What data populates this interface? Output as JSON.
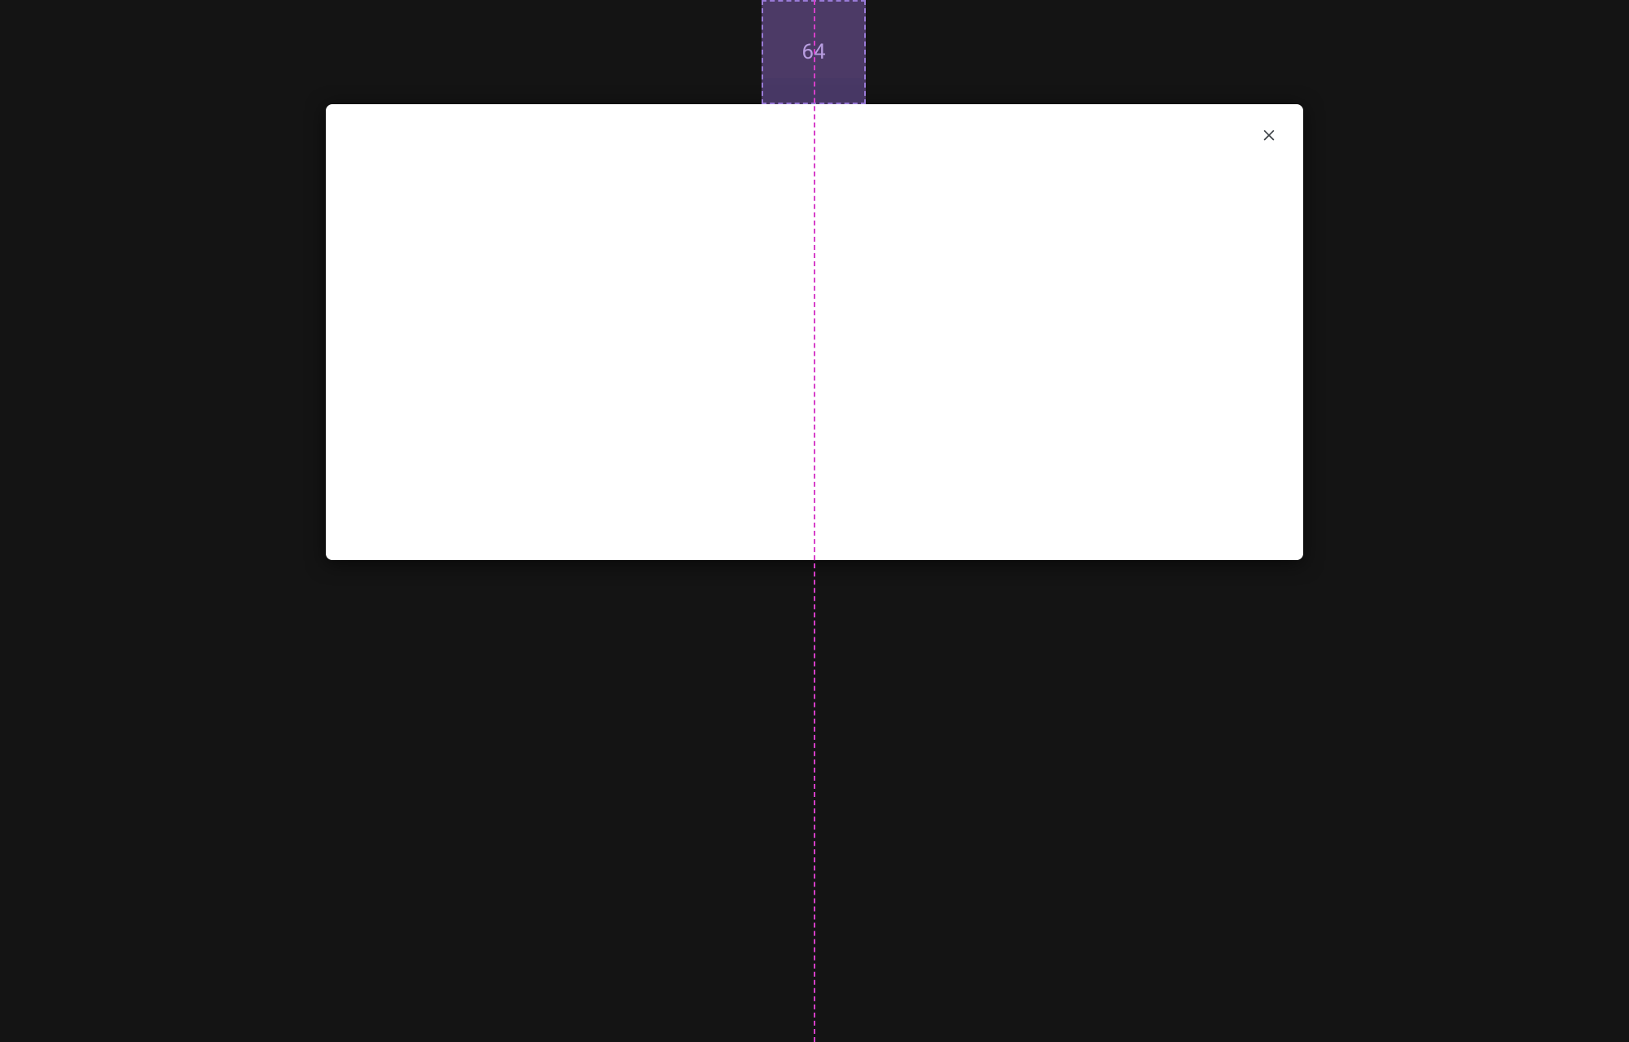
{
  "measurement": {
    "top_spacing": "64"
  },
  "modal": {
    "close_label": "Close"
  },
  "colors": {
    "background": "#141414",
    "guide_line": "#d63fc8",
    "spacer_border": "#9a7bd8",
    "spacer_fill": "rgba(122,90,170,0.55)",
    "card_bg": "#ffffff",
    "close_icon": "#3a3f44"
  }
}
